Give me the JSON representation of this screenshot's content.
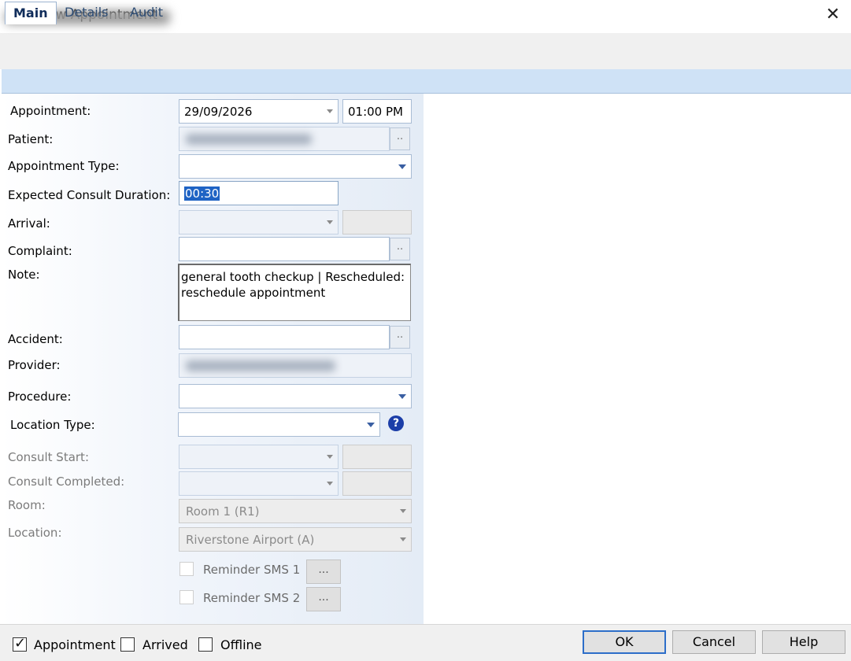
{
  "window": {
    "title": "View Appointment"
  },
  "tabs": [
    {
      "label": "Main",
      "active": true
    },
    {
      "label": "Details",
      "active": false
    },
    {
      "label": "Audit",
      "active": false
    }
  ],
  "form": {
    "appointment": {
      "label": "Appointment:",
      "date": "29/09/2026",
      "time": "01:00 PM"
    },
    "patient": {
      "label": "Patient:",
      "ellipsis": ".."
    },
    "appointment_type": {
      "label": "Appointment Type:",
      "value": ""
    },
    "duration": {
      "label": "Expected Consult Duration:",
      "value": "00:30"
    },
    "arrival": {
      "label": "Arrival:",
      "value": ""
    },
    "complaint": {
      "label": "Complaint:",
      "value": "",
      "ellipsis": ".."
    },
    "note": {
      "label": "Note:",
      "value": "general tooth checkup | Rescheduled: reschedule appointment"
    },
    "accident": {
      "label": "Accident:",
      "value": "",
      "ellipsis": ".."
    },
    "provider": {
      "label": "Provider:"
    },
    "procedure": {
      "label": "Procedure:",
      "value": ""
    },
    "location_type": {
      "label": "Location Type:",
      "value": "",
      "help": "?"
    },
    "consult_start": {
      "label": "Consult Start:"
    },
    "consult_completed": {
      "label": "Consult Completed:"
    },
    "room": {
      "label": "Room:",
      "value": "Room 1 (R1)"
    },
    "location": {
      "label": "Location:",
      "value": "Riverstone Airport (A)"
    },
    "reminders": [
      {
        "label": "Reminder SMS 1",
        "checked": false,
        "button": "..."
      },
      {
        "label": "Reminder SMS 2",
        "checked": false,
        "button": "..."
      }
    ]
  },
  "footer": {
    "checkboxes": [
      {
        "label": "Appointment",
        "checked": true
      },
      {
        "label": "Arrived",
        "checked": false
      },
      {
        "label": "Offline",
        "checked": false
      }
    ],
    "buttons": {
      "ok": "OK",
      "cancel": "Cancel",
      "help": "Help"
    }
  },
  "colors": {
    "accent": "#2d6ec9",
    "tab_strip": "#cfe2f6",
    "selection": "#1f63c4"
  },
  "icons": {
    "app": "gear-flower-icon",
    "close": "close-icon",
    "help": "question-circle-icon"
  }
}
